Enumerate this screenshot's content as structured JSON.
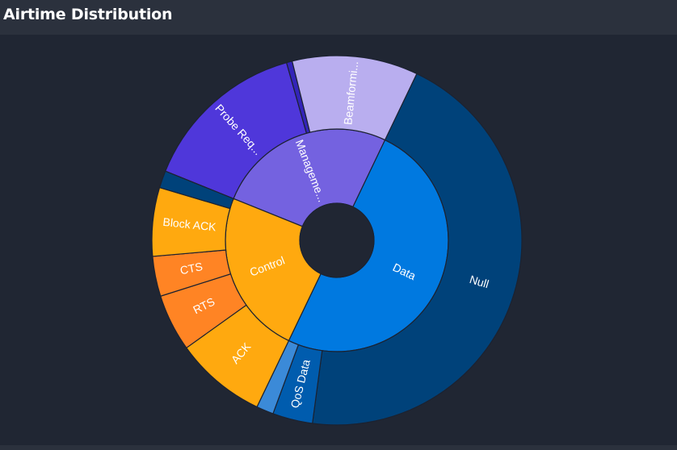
{
  "header": {
    "title": "Airtime Distribution"
  },
  "colors": {
    "background": "#202633",
    "header": "#2b313d",
    "stroke": "#1c2230"
  },
  "chart_data": {
    "type": "sunburst",
    "title": "Airtime Distribution",
    "inner": [
      {
        "label": "Management",
        "display": "Manageme...",
        "value": 26.0,
        "color": "#7462e0",
        "text": "#ffffff"
      },
      {
        "label": "Data",
        "display": "Data",
        "value": 50.0,
        "color": "#0079e0",
        "text": "#ffffff"
      },
      {
        "label": "Control",
        "display": "Control",
        "value": 24.0,
        "color": "#ffa90f",
        "text": "#ffffff"
      }
    ],
    "outer": [
      {
        "label": "Probe Req...",
        "display": "Probe Req...",
        "parent": "Management",
        "value": 14.5,
        "color": "#4f37da",
        "text": "#ffffff"
      },
      {
        "label": "",
        "parent": "Management",
        "value": 0.5,
        "color": "#3324b8",
        "text": "#ffffff"
      },
      {
        "label": "Beamformi...",
        "display": "Beamformi...",
        "parent": "Management",
        "value": 11.0,
        "color": "#b9aeef",
        "text": "#ffffff"
      },
      {
        "label": "Null",
        "display": "Null",
        "parent": "Data",
        "value": 45.0,
        "color": "#00427a",
        "text": "#ffffff"
      },
      {
        "label": "QoS Data",
        "display": "QoS Data",
        "parent": "Data",
        "value": 3.5,
        "color": "#005cae",
        "text": "#ffffff"
      },
      {
        "label": "",
        "parent": "Data",
        "value": 1.5,
        "color": "#3b8ad8",
        "text": "#ffffff"
      },
      {
        "label": "ACK",
        "display": "ACK",
        "parent": "Control",
        "value": 8.0,
        "color": "#ffa90f",
        "text": "#ffffff"
      },
      {
        "label": "RTS",
        "display": "RTS",
        "parent": "Control",
        "value": 5.0,
        "color": "#ff8424",
        "text": "#ffffff"
      },
      {
        "label": "CTS",
        "display": "CTS",
        "parent": "Control",
        "value": 3.5,
        "color": "#ff8424",
        "text": "#ffffff"
      },
      {
        "label": "Block ACK",
        "display": "Block ACK",
        "parent": "Control",
        "value": 6.0,
        "color": "#ffa90f",
        "text": "#ffffff"
      },
      {
        "label": "",
        "parent": "Control",
        "value": 1.5,
        "color": "#00427a",
        "text": "#ffffff"
      }
    ]
  }
}
